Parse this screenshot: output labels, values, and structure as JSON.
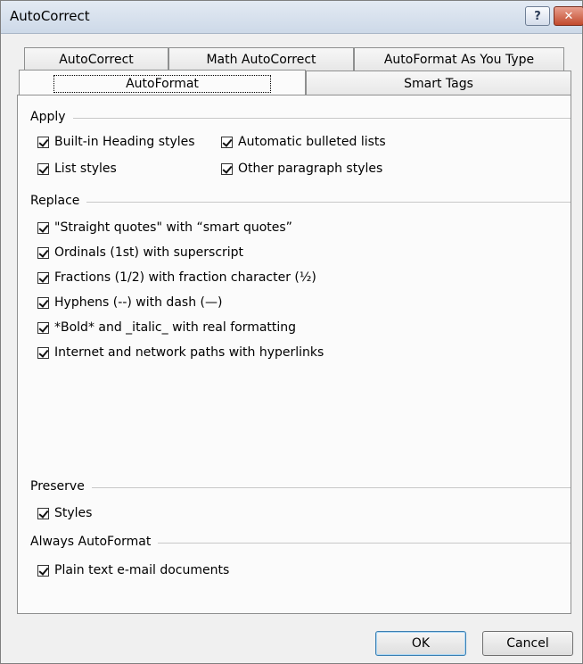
{
  "window": {
    "title": "AutoCorrect"
  },
  "titlebar": {
    "help_glyph": "?",
    "close_glyph": "✕"
  },
  "tabs": {
    "row1": [
      "AutoCorrect",
      "Math AutoCorrect",
      "AutoFormat As You Type"
    ],
    "row2": [
      "AutoFormat",
      "Smart Tags"
    ],
    "active": "AutoFormat"
  },
  "apply": {
    "label": "Apply",
    "items": [
      {
        "label": "Built-in Heading styles",
        "checked": true
      },
      {
        "label": "Automatic bulleted lists",
        "checked": true
      },
      {
        "label": "List styles",
        "checked": true
      },
      {
        "label": "Other paragraph styles",
        "checked": true
      }
    ]
  },
  "replace": {
    "label": "Replace",
    "items": [
      {
        "label": "\"Straight quotes\" with “smart quotes”",
        "checked": true
      },
      {
        "label": "Ordinals (1st) with superscript",
        "checked": true
      },
      {
        "label": "Fractions (1/2) with fraction character (½)",
        "checked": true
      },
      {
        "label": "Hyphens (--) with dash (—)",
        "checked": true
      },
      {
        "label": "*Bold* and _italic_ with real formatting",
        "checked": true
      },
      {
        "label": "Internet and network paths with hyperlinks",
        "checked": true
      }
    ]
  },
  "preserve": {
    "label": "Preserve",
    "items": [
      {
        "label": "Styles",
        "checked": true
      }
    ]
  },
  "always": {
    "label": "Always AutoFormat",
    "items": [
      {
        "label": "Plain text e-mail documents",
        "checked": true
      }
    ]
  },
  "buttons": {
    "ok": "OK",
    "cancel": "Cancel"
  }
}
